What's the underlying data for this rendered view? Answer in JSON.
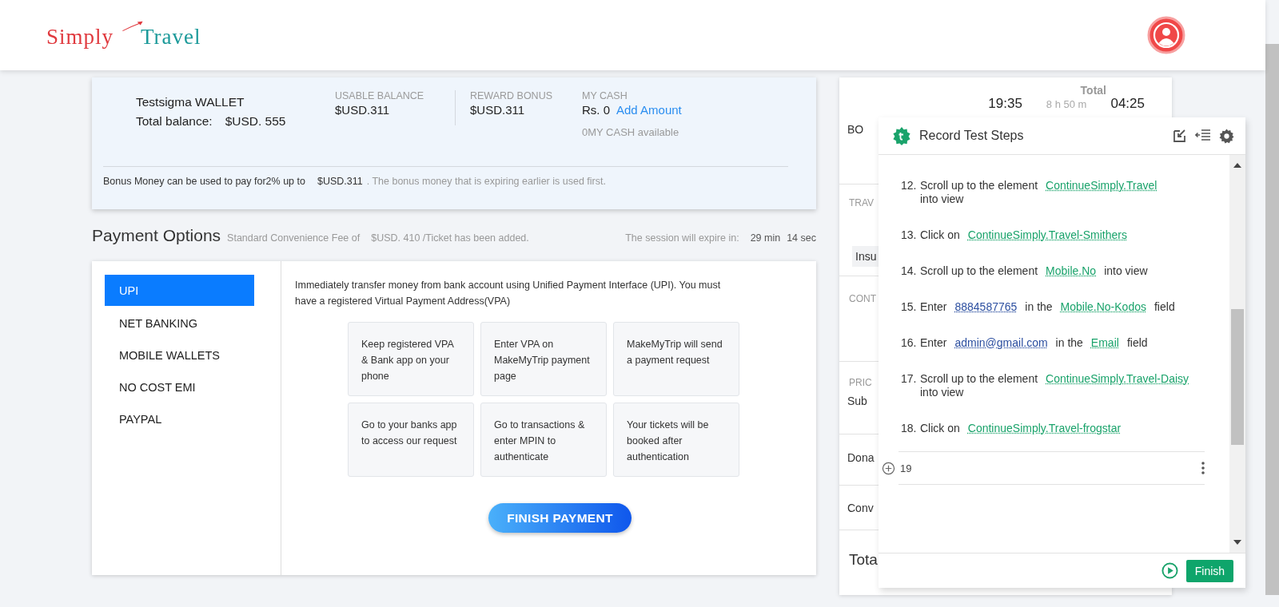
{
  "header": {
    "logo": {
      "first": "Simply",
      "second": "Travel"
    }
  },
  "wallet": {
    "title": "Testsigma WALLET",
    "total_label": "Total balance:",
    "total_value": "$USD. 555",
    "columns": [
      {
        "label": "USABLE BALANCE",
        "value": "$USD.311"
      },
      {
        "label": "REWARD BONUS",
        "value": "$USD.311"
      },
      {
        "label": "MY CASH",
        "value": "Rs. 0",
        "link": "Add Amount",
        "note": "0MY CASH available"
      }
    ],
    "note": {
      "lead": "Bonus Money can be used to pay for2% up to",
      "amount": "$USD.311",
      "rest": ". The bonus money that is expiring earlier is used first."
    }
  },
  "payment": {
    "title": "Payment Options",
    "fee_label": "Standard Convenience Fee of",
    "fee_value": "$USD. 410 /Ticket has been added.",
    "session_label": "The session will expire in:",
    "minutes": "29 min",
    "seconds": "14 sec",
    "methods": [
      {
        "label": "UPI",
        "selected": true
      },
      {
        "label": "NET BANKING",
        "selected": false
      },
      {
        "label": "MOBILE WALLETS",
        "selected": false
      },
      {
        "label": "NO COST EMI",
        "selected": false
      },
      {
        "label": "PAYPAL",
        "selected": false
      }
    ],
    "description": "Immediately transfer money from bank account using Unified Payment Interface (UPI). You must have a registered Virtual Payment Address(VPA)",
    "steps": [
      "Keep registered VPA & Bank app on your phone",
      "Enter VPA on MakeMyTrip payment page",
      "MakeMyTrip will send a payment request",
      "Go to your banks app to access our request",
      "Go to transactions & enter MPIN to authenticate",
      "Your tickets will be booked after authentication"
    ],
    "button": "FINISH PAYMENT"
  },
  "summary": {
    "total_heading": "Total",
    "depart": "19:35",
    "duration": "8 h 50 m",
    "arrive": "04:25",
    "labels": [
      {
        "kind": "label",
        "text": "BO"
      },
      {
        "kind": "heading",
        "text": "TRAV"
      },
      {
        "kind": "chip",
        "text": "Insu"
      },
      {
        "kind": "heading",
        "text": "CONT"
      },
      {
        "kind": "heading",
        "text": "PRIC"
      },
      {
        "kind": "label",
        "text": "Sub"
      },
      {
        "kind": "label",
        "text": "Dona"
      },
      {
        "kind": "label",
        "text": "Conv"
      },
      {
        "kind": "total",
        "text": "Tota"
      }
    ]
  },
  "recorder": {
    "title": "Record Test Steps",
    "steps": [
      {
        "number": "12.",
        "parts": [
          {
            "kind": "text",
            "text": "Scroll up to the element"
          },
          {
            "kind": "element",
            "text": "ContinueSimply.Travel"
          },
          {
            "kind": "text",
            "text": "into view"
          }
        ]
      },
      {
        "number": "13.",
        "parts": [
          {
            "kind": "text",
            "text": "Click on"
          },
          {
            "kind": "element",
            "text": "ContinueSimply.Travel-Smithers"
          }
        ]
      },
      {
        "number": "14.",
        "parts": [
          {
            "kind": "text",
            "text": "Scroll up to the element"
          },
          {
            "kind": "element",
            "text": "Mobile.No"
          },
          {
            "kind": "text",
            "text": "into view"
          }
        ]
      },
      {
        "number": "15.",
        "parts": [
          {
            "kind": "text",
            "text": "Enter"
          },
          {
            "kind": "data",
            "text": "8884587765"
          },
          {
            "kind": "text",
            "text": "in the"
          },
          {
            "kind": "element",
            "text": "Mobile.No-Kodos"
          },
          {
            "kind": "text",
            "text": "field"
          }
        ]
      },
      {
        "number": "16.",
        "parts": [
          {
            "kind": "text",
            "text": "Enter"
          },
          {
            "kind": "data",
            "text": "admin@gmail.com"
          },
          {
            "kind": "text",
            "text": "in the"
          },
          {
            "kind": "element",
            "text": "Email"
          },
          {
            "kind": "text",
            "text": "field"
          }
        ]
      },
      {
        "number": "17.",
        "parts": [
          {
            "kind": "text",
            "text": "Scroll up to the element"
          },
          {
            "kind": "element",
            "text": "ContinueSimply.Travel-Daisy"
          },
          {
            "kind": "text",
            "text": "into view"
          }
        ]
      },
      {
        "number": "18.",
        "parts": [
          {
            "kind": "text",
            "text": "Click on"
          },
          {
            "kind": "element",
            "text": "ContinueSimply.Travel-frogstar"
          }
        ]
      }
    ],
    "new_step": {
      "number": "19"
    },
    "finish": "Finish"
  }
}
